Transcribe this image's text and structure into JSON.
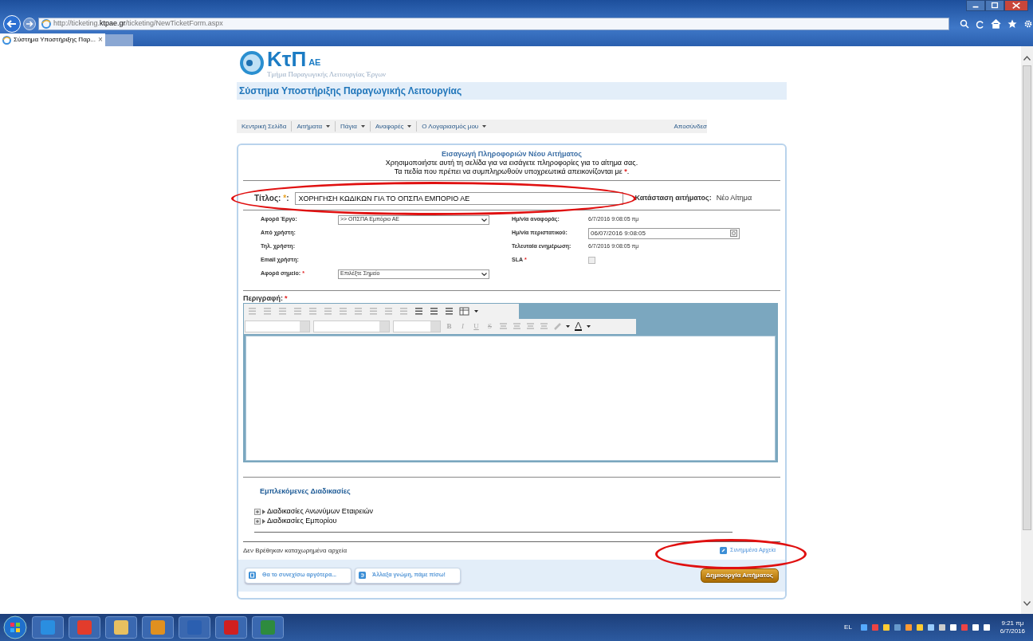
{
  "browser": {
    "address": "http://ticketing.**ktpae.gr**/ticketing/NewTicketForm.aspx",
    "tab": {
      "title": "Σύστημα Υποστήριξης Παρ...",
      "close": "×"
    }
  },
  "header": {
    "logo": "ΚτΠ",
    "logo_suffix": "ΑΕ",
    "subtitle": "Τμήμα Παραγωγικής Λειτουργίας Έργων",
    "system_title": "Σύστημα Υποστήριξης Παραγωγικής Λειτουργίας"
  },
  "nav": {
    "items": [
      {
        "label": "Κεντρική Σελίδα",
        "dropdown": false
      },
      {
        "label": "Αιτήματα",
        "dropdown": true
      },
      {
        "label": "Πάγια",
        "dropdown": true
      },
      {
        "label": "Αναφορές",
        "dropdown": true
      },
      {
        "label": "Ο Λογαριασμός μου",
        "dropdown": true
      }
    ],
    "logout": "Αποσύνδεσ"
  },
  "form": {
    "heading": "Εισαγωγή Πληροφοριών Νέου Αιτήματος",
    "intro": "Χρησιμοποιήστε αυτή τη σελίδα για να εισάγετε πληροφορίες για το αίτημα σας.",
    "required_note": "Τα πεδία που πρέπει να συμπληρωθούν υποχρεωτικά απεικονίζονται με ",
    "required_note_mark": "*",
    "required_note_end": ".",
    "title": {
      "label": "Τίτλος:",
      "mark": "*",
      "suffix": ":",
      "value": "ΧΟΡΗΓΗΣΗ ΚΩΔΙΚΩΝ ΓΙΑ ΤΟ ΟΠΣΠΑ ΕΜΠΟΡΙΟ ΑΕ"
    },
    "status": {
      "label": "Κατάσταση αιτήματος:",
      "value": "Νέο Αίτημα"
    },
    "left_fields": [
      {
        "label": "Αφορά Έργο:",
        "required": false,
        "kind": "select",
        "value": ">> ΟΠΣΠΑ Εμπόριο ΑΕ"
      },
      {
        "label": "Από χρήστη:",
        "required": false,
        "kind": "static"
      },
      {
        "label": "Τηλ. χρήστη:",
        "required": false,
        "kind": "static"
      },
      {
        "label": "Email χρήστη:",
        "required": false,
        "kind": "static"
      },
      {
        "label": "Αφορά σημείο:",
        "required": true,
        "kind": "select",
        "value": "Επιλέξτε Σημείο"
      }
    ],
    "right_fields": [
      {
        "label": "Ημ/νία αναφοράς:",
        "required": false,
        "kind": "static",
        "value": "6/7/2016 9:08:05 πμ"
      },
      {
        "label": "Ημ/νία περιστατικού:",
        "required": false,
        "kind": "datetime",
        "value": "06/07/2016 9:08:05"
      },
      {
        "label": "Τελευταία ενημέρωση:",
        "required": false,
        "kind": "static",
        "value": "6/7/2016 9:08:05 πμ"
      },
      {
        "label": "SLA",
        "required": true,
        "kind": "checkbox",
        "checked": false
      }
    ],
    "description": {
      "label": "Περιγραφή:",
      "required": true,
      "format_buttons": [
        "B",
        "I",
        "U",
        "S"
      ]
    },
    "related": {
      "heading": "Εμπλεκόμενες Διαδικασίες",
      "items": [
        {
          "label": "Διαδικασίες Ανωνύμων Εταιρειών",
          "expanded": false
        },
        {
          "label": "Διαδικασίες Εμπορίου",
          "expanded": false
        }
      ]
    },
    "attachments": {
      "note": "Δεν Βρέθηκαν καταχωρημένα αρχεία",
      "link": "Συνημμένα Αρχεία"
    },
    "buttons": [
      {
        "label": "Θα το συνεχίσω αργότερα...",
        "kind": "save"
      },
      {
        "label": "Άλλαξα γνώμη, πάμε πίσω!",
        "kind": "back"
      }
    ],
    "submit": "Δημιουργία Αιτήματος"
  },
  "highlights": [
    {
      "kind": "ellipse"
    },
    {
      "kind": "ellipse"
    }
  ],
  "taskbar": {
    "language": "EL",
    "time": "9:21 πμ",
    "date": "6/7/2016"
  }
}
